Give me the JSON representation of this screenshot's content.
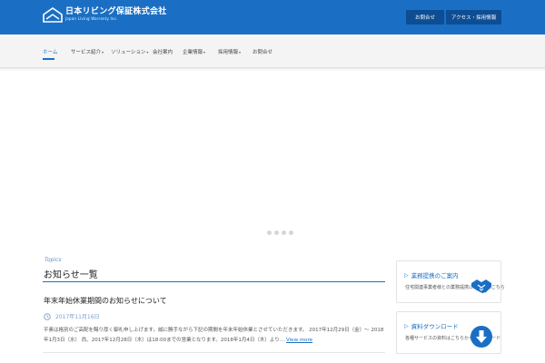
{
  "header": {
    "logo_title": "日本リビング保証株式会社",
    "logo_sub": "Japan Living Warranty Inc.",
    "buttons": [
      "お問合せ",
      "アクセス・採用情報"
    ]
  },
  "nav": {
    "items": [
      {
        "label": "ホーム",
        "caret": ""
      },
      {
        "label": "サービス紹介",
        "caret": "▾"
      },
      {
        "label": "ソリューション",
        "caret": "▾"
      },
      {
        "label": "会社案内",
        "caret": ""
      },
      {
        "label": "企業情報",
        "caret": "▾"
      },
      {
        "label": "採用情報",
        "caret": "▾"
      },
      {
        "label": "お問合せ",
        "caret": ""
      }
    ]
  },
  "slider": {
    "dot_count": 4
  },
  "topics": {
    "label": "Topics",
    "title": "お知らせ一覧",
    "post_title": "年末年始休業期間のお知らせについて",
    "post_date": "2017年11月16日",
    "post_body": "平素は格別のご高配を賜り厚く御礼申し上げます。誠に勝手ながら下記の期間を年末年始休業とさせていただきます。 2017年12月29日（金）～ 2018年1月3日（水） 尚、2017年12月28日（木）は18:00までの営業となります。2018年1月4日（木）より…",
    "view_more": "View more"
  },
  "sidebar": {
    "boxes": [
      {
        "title": "業務提携のご案内",
        "text": "住宅関連事業者様との業務提携についてはこちら",
        "icon": "handshake-icon"
      },
      {
        "title": "資料ダウンロード",
        "text": "各種サービスの資料はこちらからダウンロード",
        "icon": "download-icon"
      }
    ]
  },
  "colors": {
    "brand_blue": "#1a6fc4",
    "dark_blue": "#0d4d94"
  }
}
